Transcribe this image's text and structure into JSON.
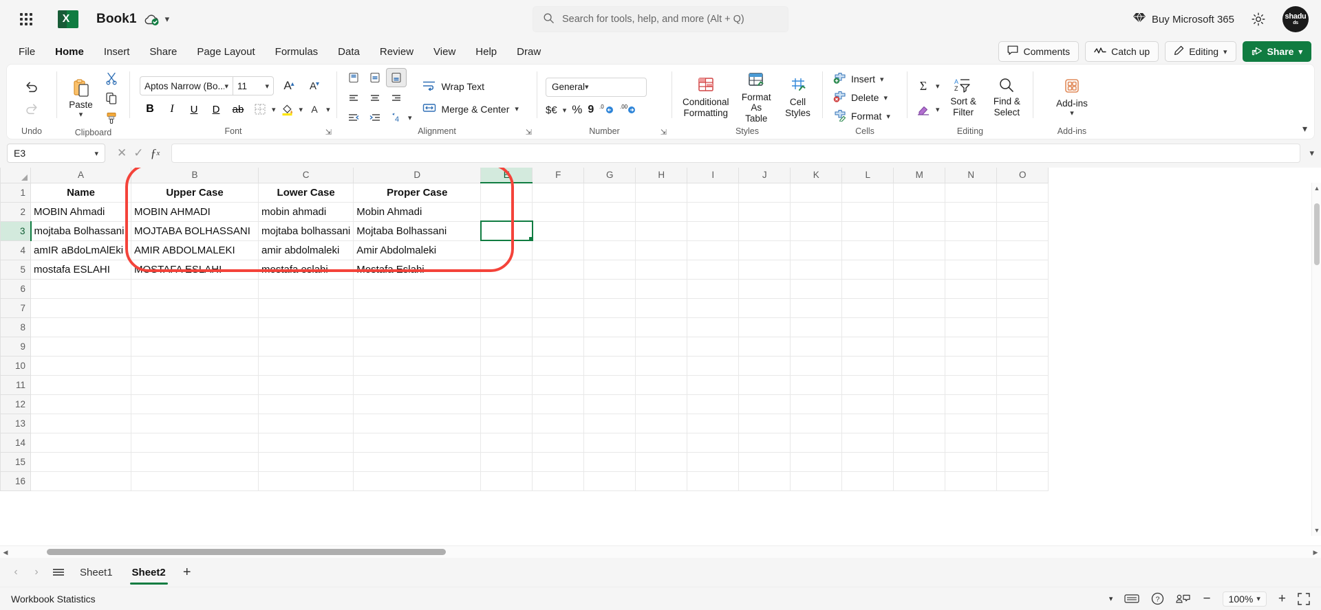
{
  "titlebar": {
    "waffle_label": "app-launcher",
    "app_logo_letter": "X",
    "document_title": "Book1",
    "search_placeholder": "Search for tools, help, and more (Alt + Q)",
    "buy_label": "Buy Microsoft 365",
    "avatar_line1": "shadu",
    "avatar_line2": "ds"
  },
  "ribbon_tabs": {
    "items": [
      {
        "label": "File",
        "active": false
      },
      {
        "label": "Home",
        "active": true
      },
      {
        "label": "Insert",
        "active": false
      },
      {
        "label": "Share",
        "active": false
      },
      {
        "label": "Page Layout",
        "active": false
      },
      {
        "label": "Formulas",
        "active": false
      },
      {
        "label": "Data",
        "active": false
      },
      {
        "label": "Review",
        "active": false
      },
      {
        "label": "View",
        "active": false
      },
      {
        "label": "Help",
        "active": false
      },
      {
        "label": "Draw",
        "active": false
      }
    ],
    "comments": "Comments",
    "catch_up": "Catch up",
    "editing": "Editing",
    "share": "Share"
  },
  "ribbon": {
    "undo_group_label": "Undo",
    "clipboard_group_label": "Clipboard",
    "paste_label": "Paste",
    "font_group_label": "Font",
    "font_name": "Aptos Narrow (Bo...",
    "font_size": "11",
    "alignment_group_label": "Alignment",
    "wrap_text": "Wrap Text",
    "merge_center": "Merge & Center",
    "number_group_label": "Number",
    "number_format": "General",
    "currency_label": "$€",
    "percent_label": "%",
    "comma_label": "9",
    "styles_group_label": "Styles",
    "conditional_formatting": "Conditional Formatting",
    "format_as_table": "Format As Table",
    "cell_styles": "Cell Styles",
    "cells_group_label": "Cells",
    "insert": "Insert",
    "delete": "Delete",
    "format": "Format",
    "editing_group_label": "Editing",
    "sort_filter": "Sort & Filter",
    "find_select": "Find & Select",
    "addins_group_label": "Add-ins",
    "addins": "Add-ins"
  },
  "formula_bar": {
    "name_box": "E3",
    "formula_value": ""
  },
  "grid": {
    "columns": [
      "A",
      "B",
      "C",
      "D",
      "E",
      "F",
      "G",
      "H",
      "I",
      "J",
      "K",
      "L",
      "M",
      "N",
      "O"
    ],
    "selected_column": "E",
    "selected_row": 3,
    "selected_cell": "E3",
    "rows": [
      {
        "num": 1,
        "cells": {
          "A": "Name",
          "B": "Upper Case",
          "C": "Lower Case",
          "D": "Proper Case"
        },
        "header": true
      },
      {
        "num": 2,
        "cells": {
          "A": "MOBIN Ahmadi",
          "B": "MOBIN AHMADI",
          "C": "mobin ahmadi",
          "D": "Mobin Ahmadi"
        }
      },
      {
        "num": 3,
        "cells": {
          "A": "mojtaba Bolhassani",
          "B": "MOJTABA BOLHASSANI",
          "C": "mojtaba bolhassani",
          "D": "Mojtaba Bolhassani"
        }
      },
      {
        "num": 4,
        "cells": {
          "A": "amIR aBdoLmAlEki",
          "B": "AMIR ABDOLMALEKI",
          "C": "amir abdolmaleki",
          "D": "Amir Abdolmaleki"
        }
      },
      {
        "num": 5,
        "cells": {
          "A": "mostafa ESLAHI",
          "B": "MOSTAFA ESLAHI",
          "C": "mostafa eslahi",
          "D": "Mostafa Eslahi"
        }
      },
      {
        "num": 6,
        "cells": {}
      },
      {
        "num": 7,
        "cells": {}
      },
      {
        "num": 8,
        "cells": {}
      },
      {
        "num": 9,
        "cells": {}
      },
      {
        "num": 10,
        "cells": {}
      },
      {
        "num": 11,
        "cells": {}
      },
      {
        "num": 12,
        "cells": {}
      },
      {
        "num": 13,
        "cells": {}
      },
      {
        "num": 14,
        "cells": {}
      },
      {
        "num": 15,
        "cells": {}
      },
      {
        "num": 16,
        "cells": {}
      }
    ],
    "annotation_color": "#f4433a"
  },
  "sheet_tabs": {
    "items": [
      {
        "label": "Sheet1",
        "active": false
      },
      {
        "label": "Sheet2",
        "active": true
      }
    ],
    "add_label": "+"
  },
  "status_bar": {
    "workbook_statistics": "Workbook Statistics",
    "zoom": "100%"
  },
  "colors": {
    "excel_green": "#107c41",
    "dark_green": "#185c37",
    "annotation_red": "#f4433a",
    "selection_green_bg": "#d3eadd"
  }
}
